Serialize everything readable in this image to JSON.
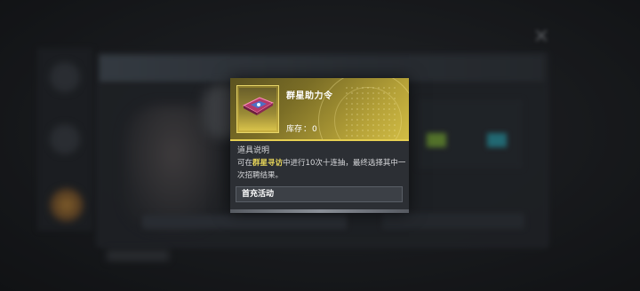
{
  "item": {
    "name": "群星助力令",
    "stock_label": "库存",
    "stock_value": "0",
    "icon": "star-token-icon"
  },
  "description": {
    "title": "道具说明",
    "text_before": "可在",
    "highlight": "群星寻访",
    "text_after": "中进行10次十连抽，最终选择其中一次招聘结果。"
  },
  "source": {
    "label": "首充活动"
  },
  "colors": {
    "accent_gold": "#e6cf52",
    "highlight_text": "#e8d65a",
    "card_bg": "#2c2f34"
  }
}
